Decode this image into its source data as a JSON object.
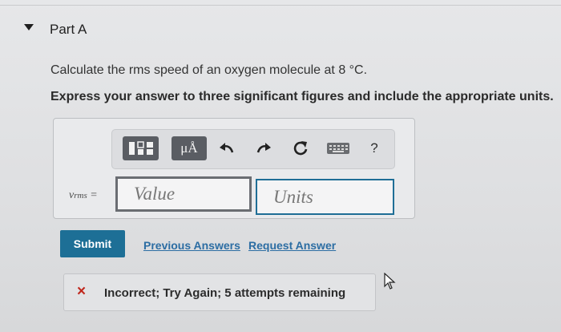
{
  "part": {
    "title": "Part A"
  },
  "question": {
    "text": "Calculate the rms speed of an oxygen molecule at 8 °C.",
    "instruction": "Express your answer to three significant figures and include the appropriate units."
  },
  "toolbar": {
    "units_label": "μÅ",
    "help_label": "?"
  },
  "answer": {
    "variable": "v",
    "variable_sub": "rms",
    "equals": "=",
    "value_placeholder": "Value",
    "units_placeholder": "Units"
  },
  "actions": {
    "submit_label": "Submit",
    "previous_answers_label": "Previous Answers",
    "request_answer_label": "Request Answer"
  },
  "feedback": {
    "icon": "×",
    "text": "Incorrect; Try Again; 5 attempts remaining"
  },
  "colors": {
    "submit_bg": "#1d6f96",
    "link": "#2c6da3",
    "error": "#c0281d"
  }
}
